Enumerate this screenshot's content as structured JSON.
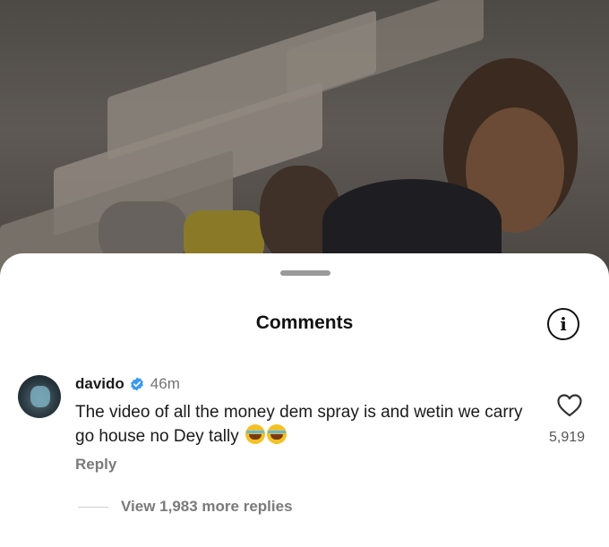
{
  "sheet": {
    "title": "Comments"
  },
  "comment": {
    "username": "davido",
    "verified": true,
    "time": "46m",
    "text": "The video of all the money dem spray is and wetin we carry go house no Dey tally",
    "emojis": [
      "face-with-tears-of-joy",
      "face-with-tears-of-joy"
    ],
    "reply_label": "Reply",
    "like_count": "5,919",
    "view_replies_label": "View 1,983 more replies"
  },
  "colors": {
    "verified_badge": "#3897f0",
    "secondary_text": "#737373",
    "emoji": "#f2c126"
  },
  "icons": {
    "info": "info-icon",
    "like": "heart-icon",
    "verified": "verified-badge-icon"
  }
}
